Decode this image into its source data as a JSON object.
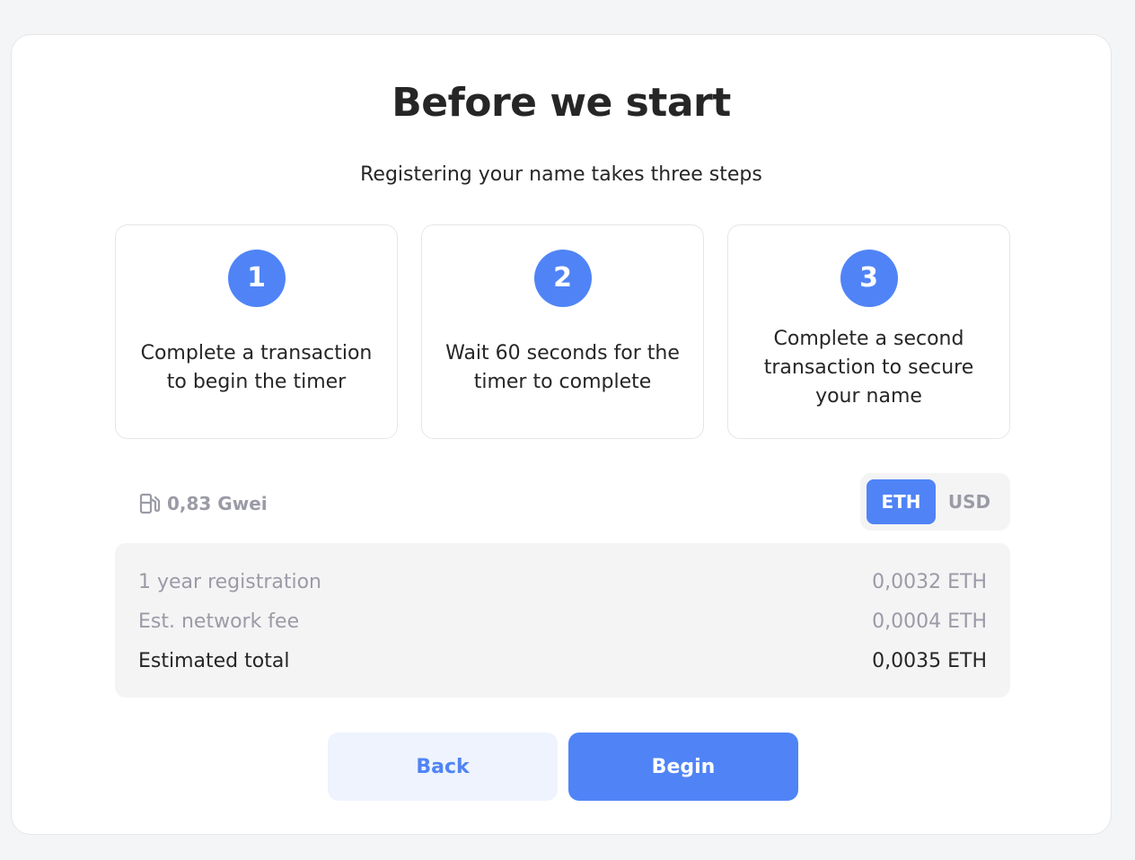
{
  "header": {
    "title": "Before we start",
    "subtitle": "Registering your name takes three steps"
  },
  "steps": [
    {
      "number": "1",
      "text": "Complete a transaction to begin the timer"
    },
    {
      "number": "2",
      "text": "Wait 60 seconds for the timer to complete"
    },
    {
      "number": "3",
      "text": "Complete a second transaction to secure your name"
    }
  ],
  "gas": {
    "icon": "gas-pump-icon",
    "value": "0,83 Gwei"
  },
  "currency_toggle": {
    "options": [
      "ETH",
      "USD"
    ],
    "selected": "ETH"
  },
  "summary": {
    "rows": [
      {
        "label": "1 year registration",
        "value": "0,0032 ETH"
      },
      {
        "label": "Est. network fee",
        "value": "0,0004 ETH"
      },
      {
        "label": "Estimated total",
        "value": "0,0035 ETH"
      }
    ]
  },
  "actions": {
    "back_label": "Back",
    "begin_label": "Begin"
  },
  "colors": {
    "accent": "#5084f6",
    "accent_light": "#eef3fd",
    "muted": "#9b9ba7",
    "panel": "#f4f4f5"
  }
}
